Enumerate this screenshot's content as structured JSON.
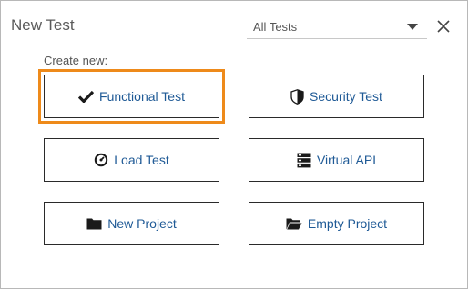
{
  "dialog": {
    "title": "New Test",
    "filter_value": "All Tests",
    "close_icon": "close-icon"
  },
  "create": {
    "label": "Create new:",
    "options": [
      {
        "label": "Functional Test",
        "icon": "checkmark-icon",
        "selected": true
      },
      {
        "label": "Security Test",
        "icon": "shield-icon",
        "selected": false
      },
      {
        "label": "Load Test",
        "icon": "gauge-icon",
        "selected": false
      },
      {
        "label": "Virtual API",
        "icon": "server-icon",
        "selected": false
      },
      {
        "label": "New Project",
        "icon": "folder-icon",
        "selected": false
      },
      {
        "label": "Empty Project",
        "icon": "open-folder-icon",
        "selected": false
      }
    ]
  },
  "colors": {
    "accent": "#ee8a1a",
    "tile_text": "#1f5a96",
    "icon": "#1a1a1a"
  }
}
